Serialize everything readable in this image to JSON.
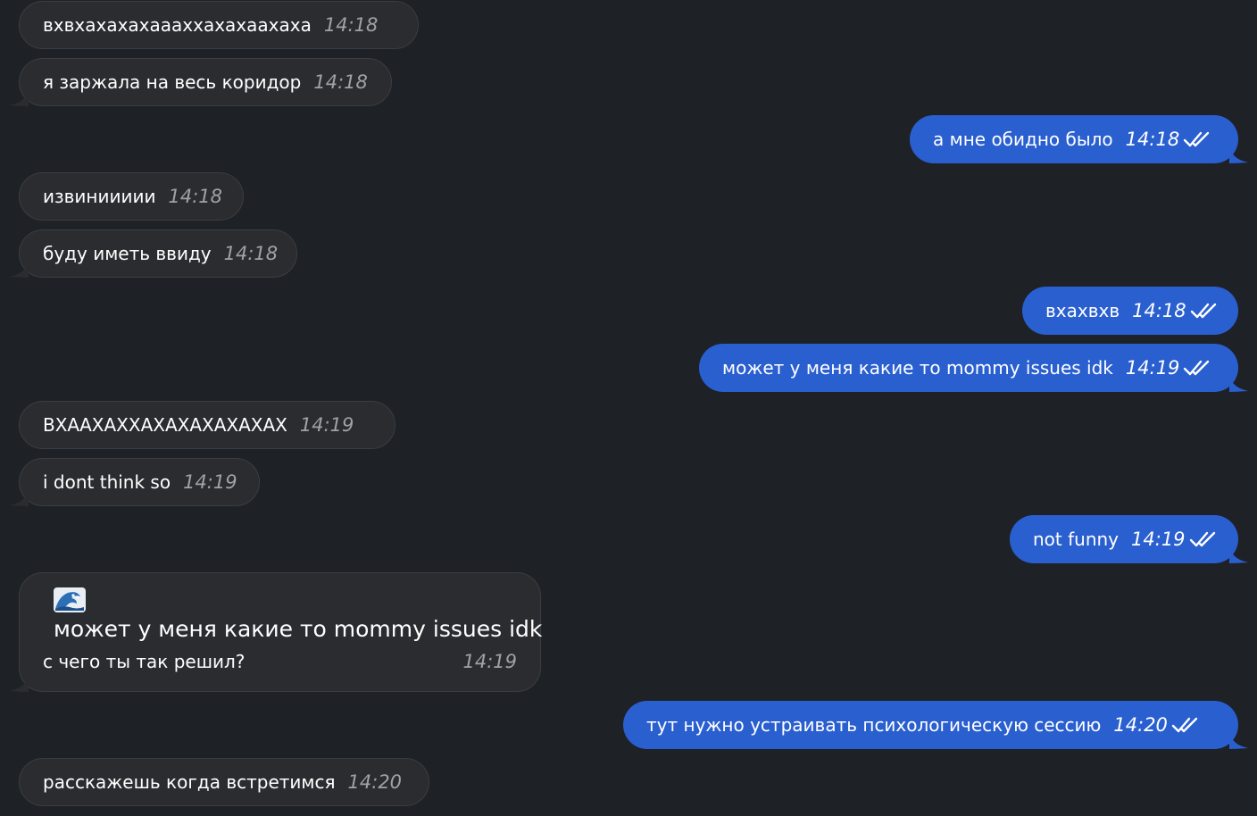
{
  "colors": {
    "background": "#1e2125",
    "incoming_bubble": "#2a2c2f",
    "outgoing_bubble": "#2a5fd0",
    "timestamp_incoming": "#9ea3a9"
  },
  "messages": [
    {
      "side": "in",
      "text": "вхвхахахахаааххахахаахаха",
      "time": "14:18"
    },
    {
      "side": "in",
      "text": "я заржала на весь коридор",
      "time": "14:18"
    },
    {
      "side": "out",
      "text": "а мне обидно было",
      "time": "14:18",
      "status_icon": "double-check-icon"
    },
    {
      "side": "in",
      "text": "извиниииии",
      "time": "14:18"
    },
    {
      "side": "in",
      "text": "буду иметь ввиду",
      "time": "14:18"
    },
    {
      "side": "out",
      "text": "вхахвхв",
      "time": "14:18",
      "status_icon": "double-check-icon"
    },
    {
      "side": "out",
      "text": "может у меня какие то mommy issues idk",
      "time": "14:19",
      "status_icon": "double-check-icon"
    },
    {
      "side": "in",
      "text": "ВХААХАХХАХАХАХАХАХАХ",
      "time": "14:19"
    },
    {
      "side": "in",
      "text": "i dont think so",
      "time": "14:19"
    },
    {
      "side": "out",
      "text": "not funny",
      "time": "14:19",
      "status_icon": "double-check-icon"
    },
    {
      "side": "out",
      "text": "тут нужно устраивать психологическую сессию",
      "time": "14:20",
      "status_icon": "double-check-icon"
    },
    {
      "side": "in",
      "text": "расскажешь когда встретимся",
      "time": "14:20"
    }
  ],
  "reply_message": {
    "side": "in",
    "quoted_icon": "wave-emoji-icon",
    "quoted_text": "может у меня какие то mommy issues idk",
    "text": "с чего ты так решил?",
    "time": "14:19"
  }
}
